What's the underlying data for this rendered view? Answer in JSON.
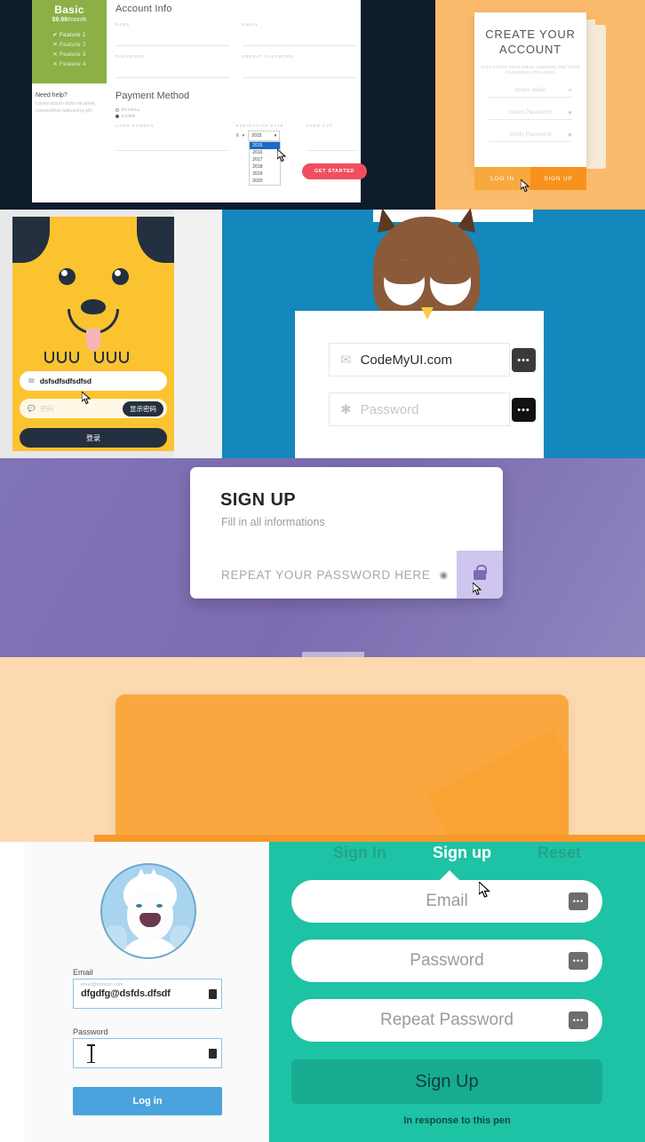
{
  "panel_signup_plan": {
    "plan": {
      "title": "Basic",
      "price": "$9.99",
      "period": "/month",
      "features": [
        "Feature 1",
        "Feature 2",
        "Feature 3",
        "Feature 4"
      ]
    },
    "help": {
      "title": "Need help?",
      "body": "Lorem ipsum dolor sit amet, consectetur adipiscing elit."
    },
    "account_section_title": "Account Info",
    "fields": {
      "name_label": "NAME",
      "email_label": "EMAIL",
      "password_label": "PASSWORD",
      "repeat_password_label": "REPEAT PASSWORD"
    },
    "payment_section_title": "Payment Method",
    "radios": [
      {
        "label": "PAYPAL",
        "selected": false
      },
      {
        "label": "CARD",
        "selected": true
      }
    ],
    "payment_labels": {
      "card_number": "CARD NUMBER",
      "expiration_date": "EXPIRATION DATE",
      "card_cvc": "CARD CVC"
    },
    "month_value": "6",
    "year_value": "2015",
    "year_options": [
      "2015",
      "2016",
      "2017",
      "2018",
      "2019",
      "2020"
    ],
    "selected_year_index": 0,
    "submit_label": "GET STARTED",
    "colors": {
      "plan_green": "#8cb046",
      "accent_red": "#ef4f5f",
      "background_dark": "#0d1b2a"
    }
  },
  "panel_create_account": {
    "title_line1": "CREATE YOUR",
    "title_line2": "ACCOUNT",
    "subtitle": "JUST ENTER YOUR EMAIL ADDRESS AND YOUR PASSWORD FOR LOGIN",
    "fields": [
      {
        "placeholder": "Insert eMail",
        "icon": "mail-icon"
      },
      {
        "placeholder": "Insert Password",
        "icon": "eye-icon"
      },
      {
        "placeholder": "Verify Password",
        "icon": "eye-icon"
      }
    ],
    "login_label": "LOG IN",
    "signup_label": "SIGN UP",
    "colors": {
      "background": "#fbbb6c",
      "button_login": "#f8a93e",
      "button_signup": "#f7921e"
    }
  },
  "panel_dog_login": {
    "phone_value": "dsfsdfsdfsdfsd",
    "password_placeholder": "密码",
    "show_password_label": "显示密码",
    "login_label": "登录",
    "icons": {
      "phone": "phone-icon",
      "lock": "chat-icon"
    },
    "colors": {
      "card": "#fcc330",
      "dark": "#24303f"
    }
  },
  "panel_owl_login": {
    "email_value": "CodeMyUI.com",
    "password_placeholder": "Password",
    "email_icon": "mail-icon",
    "password_icon": "asterisk-icon",
    "colors": {
      "background": "#1487bc",
      "owl": "#8a5a3a"
    }
  },
  "panel_purple_signup": {
    "title": "SIGN UP",
    "subtitle": "Fill in all informations",
    "field_placeholder": "REPEAT YOUR PASSWORD HERE",
    "eye_icon": "eye-icon",
    "lock_icon": "lock-icon",
    "colors": {
      "background": "#7c6bb0",
      "lock_panel": "#cfc6ef"
    }
  },
  "panel_orange_card": {
    "colors": {
      "background": "#fcd9ae",
      "card": "#faa740"
    }
  },
  "panel_yeti_login": {
    "avatar": "yeti-avatar",
    "email_label": "Email",
    "email_placeholder": "email@domain.com",
    "email_value": "dfgdfg@dsfds.dfsdf",
    "password_label": "Password",
    "password_value": "",
    "login_label": "Log in",
    "colors": {
      "button": "#4aa3dc",
      "border": "#8fc4e3"
    }
  },
  "panel_green_signup": {
    "tabs": [
      {
        "label": "Sign In",
        "active": false
      },
      {
        "label": "Sign up",
        "active": true
      },
      {
        "label": "Reset",
        "active": false
      }
    ],
    "fields": [
      {
        "placeholder": "Email"
      },
      {
        "placeholder": "Password"
      },
      {
        "placeholder": "Repeat Password"
      }
    ],
    "submit_label": "Sign Up",
    "footer_text": "In response to this pen",
    "colors": {
      "background": "#1ec2a4",
      "button": "#17ab92",
      "tab_inactive": "#22a58c"
    }
  }
}
